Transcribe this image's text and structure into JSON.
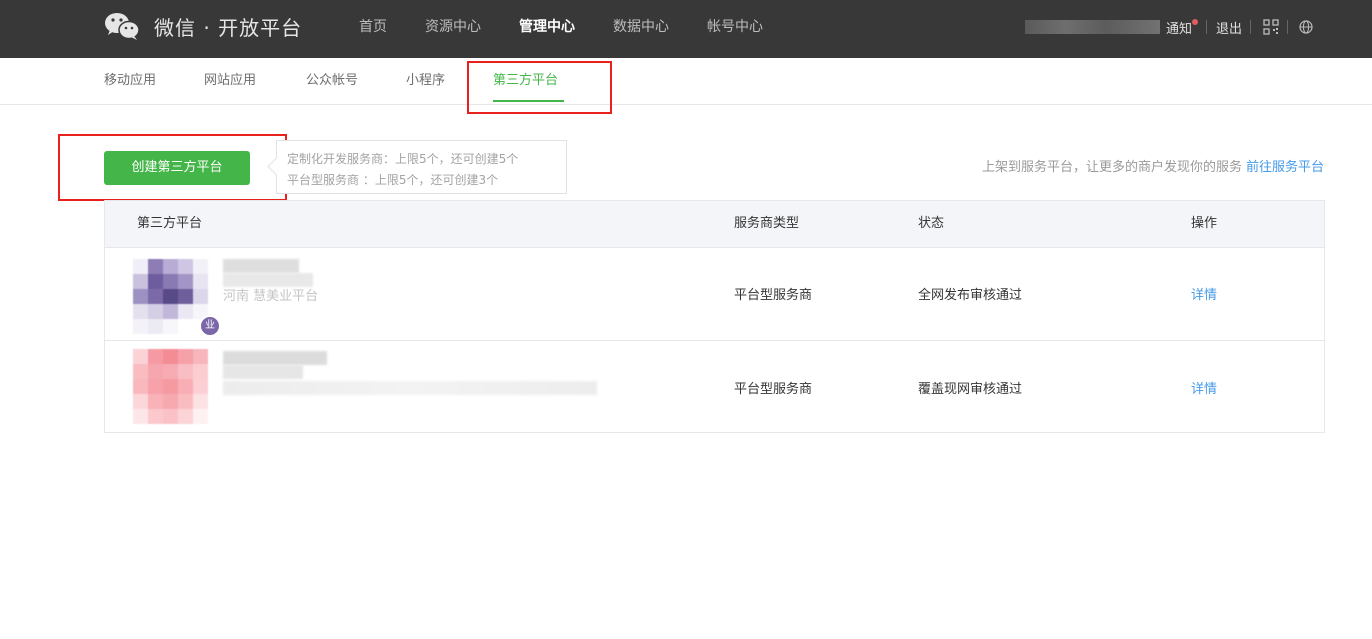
{
  "brand": {
    "logo": "wechat-logo",
    "title": "微信 · 开放平台"
  },
  "top_nav": [
    {
      "label": "首页",
      "active": false
    },
    {
      "label": "资源中心",
      "active": false
    },
    {
      "label": "管理中心",
      "active": true
    },
    {
      "label": "数据中心",
      "active": false
    },
    {
      "label": "帐号中心",
      "active": false
    }
  ],
  "top_right": {
    "notify": "通知",
    "logout": "退出",
    "icons": [
      "qr-code-icon",
      "globe-icon"
    ]
  },
  "sub_nav": [
    {
      "label": "移动应用",
      "active": false
    },
    {
      "label": "网站应用",
      "active": false
    },
    {
      "label": "公众帐号",
      "active": false
    },
    {
      "label": "小程序",
      "active": false
    },
    {
      "label": "第三方平台",
      "active": true
    }
  ],
  "create": {
    "button": "创建第三方平台",
    "tip_line1": "定制化开发服务商：上限5个，还可创建5个",
    "tip_line2": "平台型服务商 ：上限5个，还可创建3个"
  },
  "promo": {
    "text": "上架到服务平台，让更多的商户发现你的服务",
    "link": "前往服务平台"
  },
  "table": {
    "headers": [
      "第三方平台",
      "服务商类型",
      "状态",
      "操作"
    ],
    "rows": [
      {
        "name": "河南 慧美业平台",
        "type": "平台型服务商",
        "status": "全网发布审核通过",
        "action": "详情"
      },
      {
        "name": "",
        "type": "平台型服务商",
        "status": "覆盖现网审核通过",
        "action": "详情"
      }
    ]
  },
  "colors": {
    "topbar": "#383838",
    "accent_green": "#44b549",
    "link_blue": "#459ae9",
    "highlight_red": "#e8211c"
  }
}
